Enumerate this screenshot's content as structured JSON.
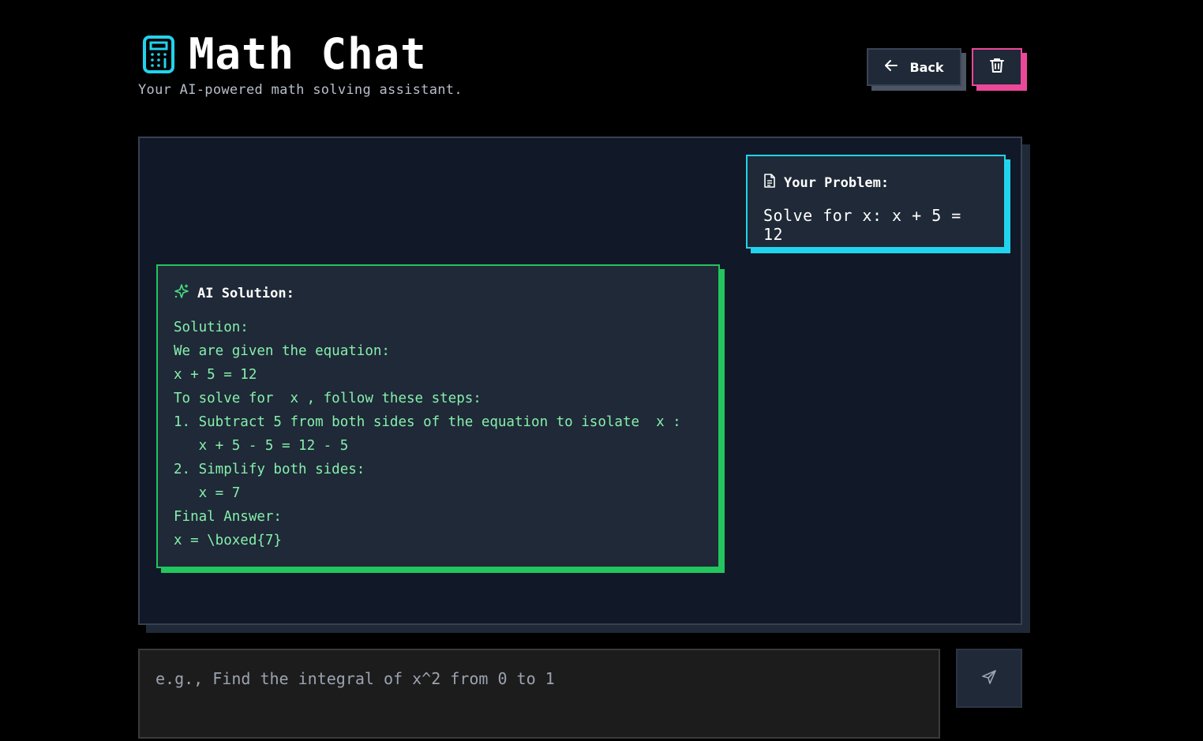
{
  "header": {
    "title": "Math Chat",
    "subtitle": "Your AI-powered math solving assistant.",
    "icon": "calculator-icon",
    "back_label": "Back"
  },
  "colors": {
    "accent_cyan": "#22d3ee",
    "accent_green": "#22c55e",
    "accent_pink": "#ec4899",
    "panel_bg": "#111827",
    "card_bg": "#1f2937",
    "solution_text": "#86efac"
  },
  "messages": {
    "user": {
      "heading": "Your Problem:",
      "icon": "document-icon",
      "text": "Solve for x: x + 5 = 12"
    },
    "ai": {
      "heading": "AI Solution:",
      "icon": "sparkle-icon",
      "lines": [
        "Solution:",
        "We are given the equation:",
        "x + 5 = 12",
        "To solve for  x , follow these steps:",
        "1. Subtract 5 from both sides of the equation to isolate  x :",
        "   x + 5 - 5 = 12 - 5",
        "2. Simplify both sides:",
        "   x = 7",
        "Final Answer:",
        "x = \\boxed{7}"
      ]
    }
  },
  "input": {
    "placeholder": "e.g., Find the integral of x^2 from 0 to 1",
    "value": ""
  },
  "icons": {
    "back": "arrow-left-icon",
    "delete": "trash-icon",
    "send": "send-icon"
  }
}
